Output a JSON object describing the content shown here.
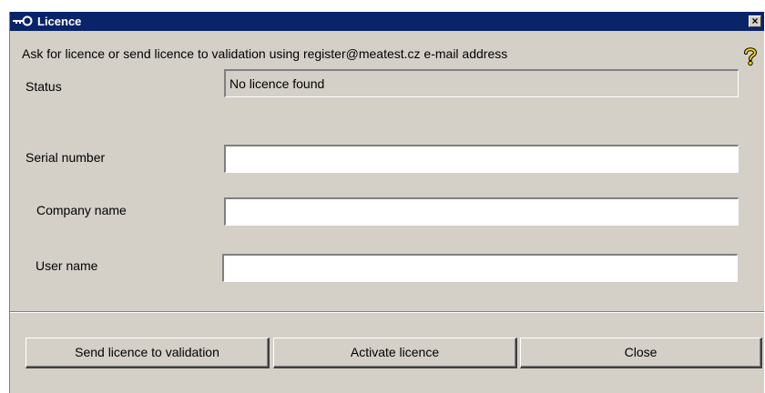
{
  "window": {
    "title": "Licence",
    "close_glyph": "×"
  },
  "instructions": "Ask for licence or send licence to validation using register@meatest.cz e-mail address",
  "help_icon": "help-question-icon",
  "form": {
    "status": {
      "label": "Status",
      "value": "No licence found"
    },
    "serial_number": {
      "label": "Serial number",
      "value": ""
    },
    "company_name": {
      "label": "Company name",
      "value": ""
    },
    "user_name": {
      "label": "User name",
      "value": ""
    }
  },
  "buttons": {
    "send": "Send licence to validation",
    "activate": "Activate licence",
    "close": "Close"
  },
  "colors": {
    "titlebar": "#0a246a",
    "dialog_bg": "#d4d0c8",
    "help_icon": "#f5d800"
  }
}
